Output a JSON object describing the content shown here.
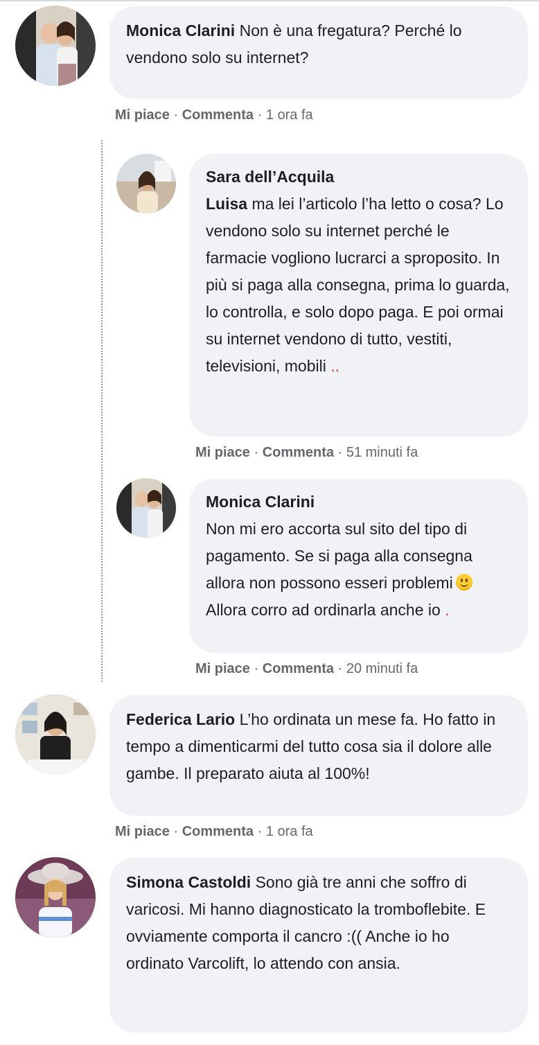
{
  "comments": [
    {
      "author": "Monica Clarini",
      "text": " Non è una fregatura? Perché lo vendono solo su internet?",
      "like": "Mi piace",
      "reply": "Commenta",
      "sep": " · ",
      "time": "1 ora fa"
    },
    {
      "author": "Federica Lario",
      "text": " L’ho ordinata un mese fa. Ho fatto in tempo a dimenticarmi del tutto cosa sia il dolore alle gambe. Il preparato aiuta al 100%!",
      "like": "Mi piace",
      "reply": "Commenta",
      "sep": " · ",
      "time": "1 ora fa"
    },
    {
      "author": "Simona Castoldi",
      "text": " Sono già tre anni che soffro di varicosi. Mi hanno diagnosticato la tromboflebite. E ovviamente comporta il cancro :(( Anche io ho ordinato Varcolift, lo attendo con ansia."
    }
  ],
  "replies": [
    {
      "author": "Sara dell’Acquila",
      "mention": "Luisa",
      "text": " ma lei l’articolo l’ha letto o cosa? Lo vendono solo su internet perché le farmacie vogliono lucrarci a sproposito. In più si paga alla consegna, prima lo guarda, lo controlla, e solo dopo paga. E poi ormai su internet vendono di tutto, vestiti, televisioni, mobili ",
      "trailing": "..",
      "like": "Mi piace",
      "reply": "Commenta",
      "sep": " · ",
      "time": "51 minuti fa"
    },
    {
      "author": "Monica Clarini",
      "text": "Non mi ero accorta sul sito del tipo di pagamento. Se si paga alla consegna allora non possono esseri problemi",
      "emoji": "slightly-smiling-face-icon",
      "text2": "Allora corro ad ordinarla anche io ",
      "trailing": ".",
      "like": "Mi piace",
      "reply": "Commenta",
      "sep": " · ",
      "time": "20 minuti fa"
    }
  ],
  "colors": {
    "bubble": "#f0f2f5",
    "meta": "#65676b",
    "text": "#1c1e21",
    "accent_dot": "#d7263d"
  }
}
